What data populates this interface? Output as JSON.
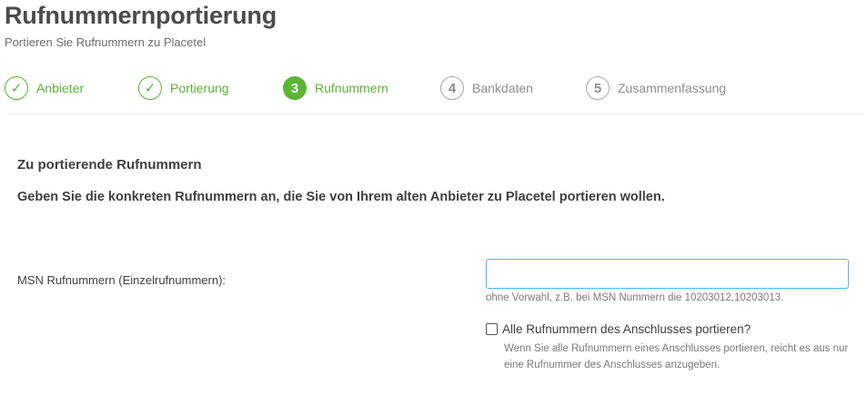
{
  "header": {
    "title": "Rufnummernportierung",
    "subtitle": "Portieren Sie Rufnummern zu Placetel"
  },
  "steps": [
    {
      "marker": "✓",
      "label": "Anbieter",
      "status": "done"
    },
    {
      "marker": "✓",
      "label": "Portierung",
      "status": "done"
    },
    {
      "marker": "3",
      "label": "Rufnummern",
      "status": "active"
    },
    {
      "marker": "4",
      "label": "Bankdaten",
      "status": "pending"
    },
    {
      "marker": "5",
      "label": "Zusammenfassung",
      "status": "pending"
    }
  ],
  "section": {
    "title": "Zu portierende Rufnummern",
    "lead": "Geben Sie die konkreten Rufnummern an, die Sie von Ihrem alten Anbieter zu Placetel portieren wollen."
  },
  "msn_field": {
    "label": "MSN Rufnummern (Einzelrufnummern):",
    "value": "",
    "placeholder": "",
    "hint": "ohne Vorwahl, z.B. bei MSN Nummern die 10203012,10203013."
  },
  "all_numbers": {
    "label": "Alle Rufnummern des Anschlusses portieren?",
    "checked": false,
    "hint": "Wenn Sie alle Rufnummern eines Anschlusses portieren, reicht es aus nur eine Rufnummer des Anschlusses anzugeben."
  },
  "colors": {
    "accent_green": "#5bb535",
    "input_focus_border": "#4fb6e0",
    "pending_grey": "#a9a9a9"
  }
}
